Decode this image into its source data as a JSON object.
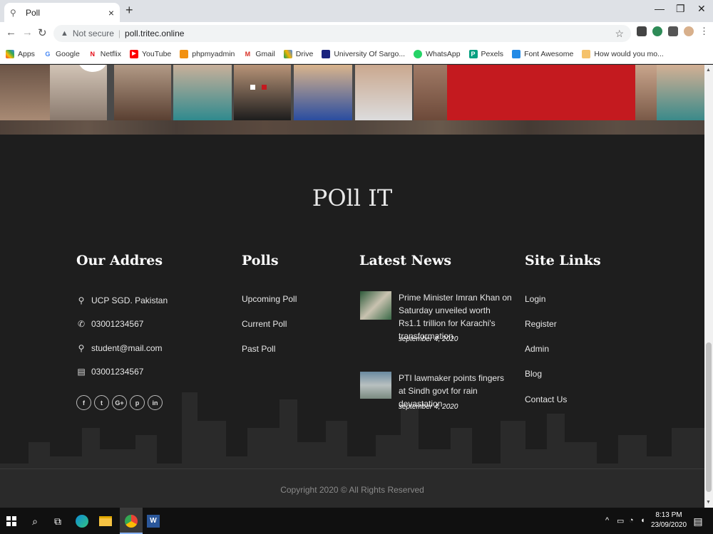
{
  "browser": {
    "tab_title": "Poll",
    "new_tab": "+",
    "tab_close": "×",
    "security_label": "Not secure",
    "url": "poll.tritec.online",
    "bookmarks": [
      "Apps",
      "Google",
      "Netflix",
      "YouTube",
      "phpmyadmin",
      "Gmail",
      "Drive",
      "University Of Sargo...",
      "WhatsApp",
      "Pexels",
      "Font Awesome",
      "How would you mo..."
    ]
  },
  "footer": {
    "brand": "POll IT",
    "address": {
      "title": "Our Addres",
      "items": [
        {
          "icon": "map-marker-icon",
          "text": "UCP SGD. Pakistan"
        },
        {
          "icon": "phone-icon",
          "text": "03001234567"
        },
        {
          "icon": "map-marker-icon",
          "text": "student@mail.com"
        },
        {
          "icon": "fax-icon",
          "text": "03001234567"
        }
      ],
      "socials": [
        "f",
        "t",
        "G+",
        "p",
        "in"
      ]
    },
    "polls": {
      "title": "Polls",
      "links": [
        "Upcoming Poll",
        "Current Poll",
        "Past Poll"
      ]
    },
    "news": {
      "title": "Latest News",
      "items": [
        {
          "title": "Prime Minister Imran Khan on Saturday unveiled worth Rs1.1 trillion for Karachi's transformation",
          "date": "september 4, 2020"
        },
        {
          "title": "PTI lawmaker points fingers at Sindh govt for rain devastation",
          "date": "september 4, 2020"
        }
      ]
    },
    "site_links": {
      "title": "Site Links",
      "links": [
        "Login",
        "Register",
        "Admin",
        "Blog",
        "Contact Us"
      ]
    },
    "copyright": "Copyright 2020 © All Rights Reserved"
  },
  "taskbar": {
    "time": "8:13 PM",
    "date": "23/09/2020"
  },
  "colors": {
    "accent_red": "#c41a1f",
    "footer_bg": "#1e1e1e"
  }
}
